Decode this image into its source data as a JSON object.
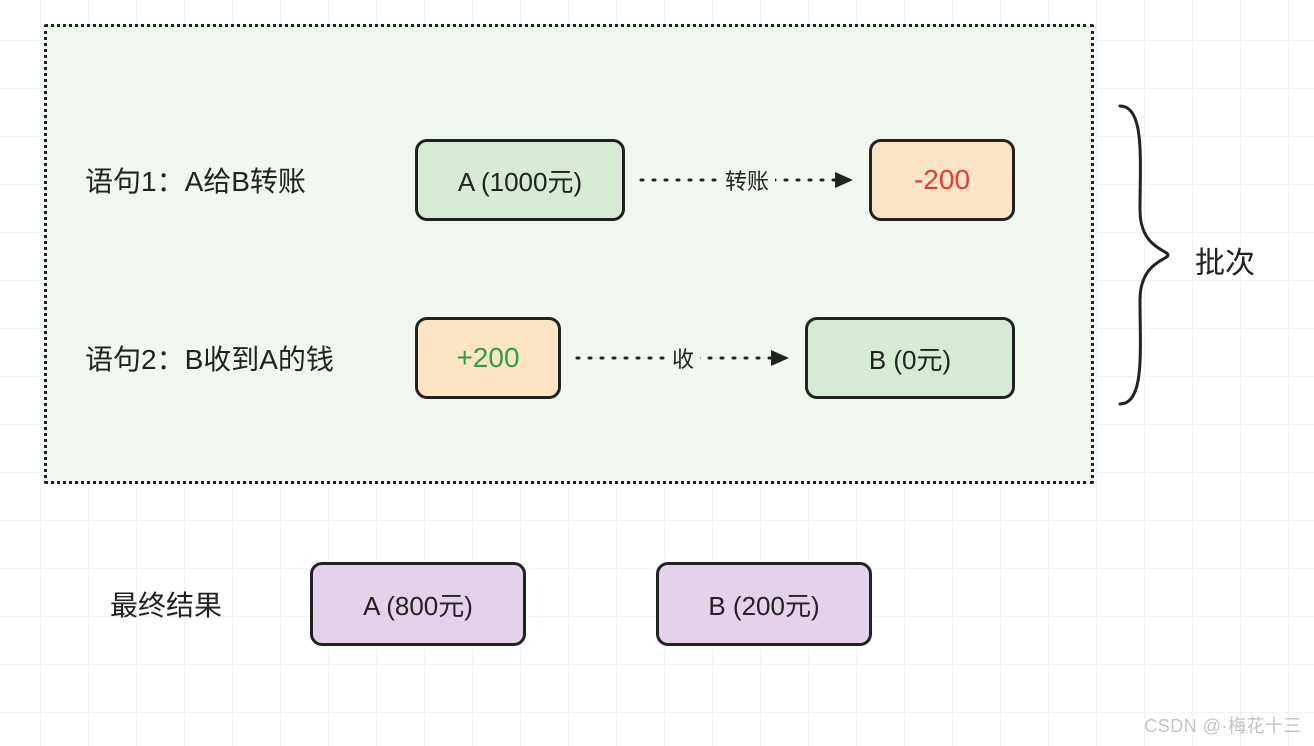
{
  "statements": {
    "s1": {
      "label": "语句1：A给B转账",
      "from_node": "A (1000元)",
      "arrow_text": "转账",
      "to_node": "-200"
    },
    "s2": {
      "label": "语句2：B收到A的钱",
      "from_node": "+200",
      "arrow_text": "收",
      "to_node": "B (0元)"
    }
  },
  "side_label": "批次",
  "result": {
    "label": "最终结果",
    "a": "A (800元)",
    "b": "B (200元)"
  },
  "watermark": "CSDN @·梅花十三",
  "colors": {
    "green": "#d7ead5",
    "orange": "#fce4c4",
    "purple": "#e3d2ea",
    "border": "#222222",
    "red_text": "#e23c39",
    "green_text": "#2f9e44",
    "batch_bg": "#eff7ee"
  }
}
